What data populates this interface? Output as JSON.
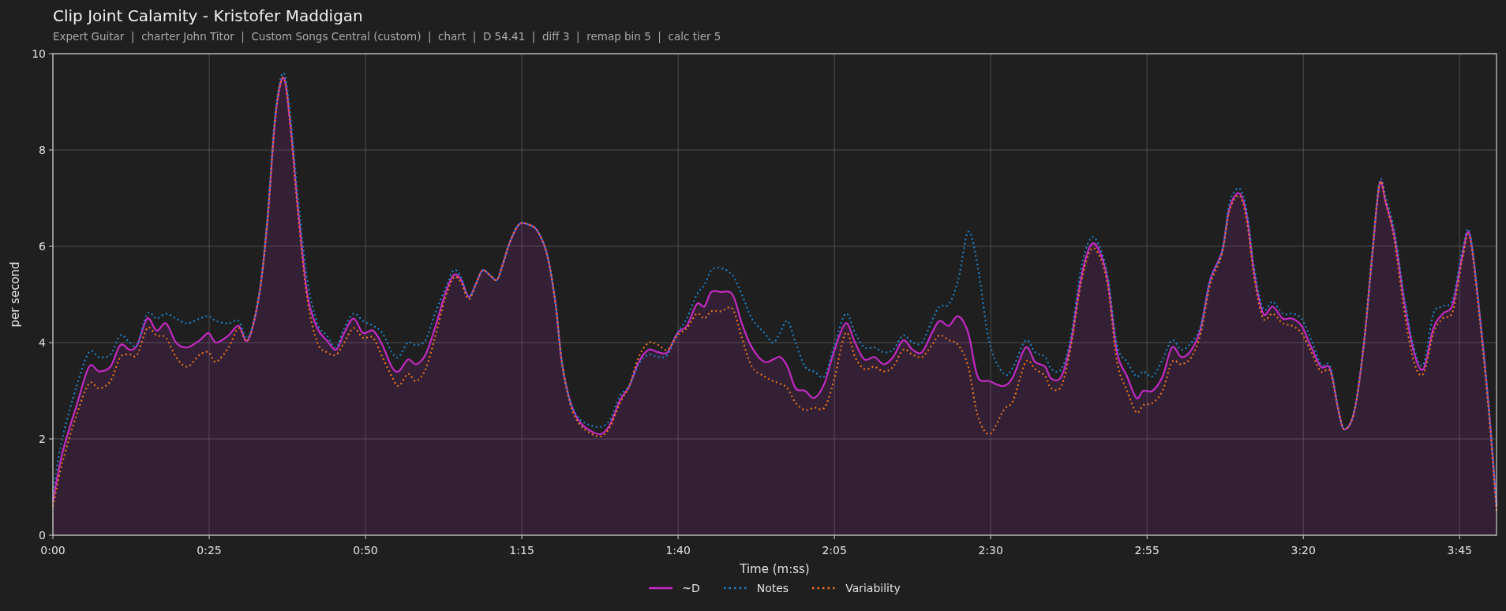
{
  "chart": {
    "subtitle": "Expert Guitar  |  charter John Titor  |  Custom Songs Central (custom)  |  chart  |  D 54.41  |  diff 3  |  remap bin 5  |  calc tier 5",
    "chart_data": {
      "type": "line",
      "title": "Clip Joint Calamity - Kristofer Maddigan",
      "xlabel": "Time (m:ss)",
      "ylabel": "per second",
      "xlim": [
        0,
        230.9
      ],
      "ylim": [
        0,
        10
      ],
      "grid": true,
      "xticks": [
        {
          "value": 0,
          "label": "0:00"
        },
        {
          "value": 25,
          "label": "0:25"
        },
        {
          "value": 50,
          "label": "0:50"
        },
        {
          "value": 75,
          "label": "1:15"
        },
        {
          "value": 100,
          "label": "1:40"
        },
        {
          "value": 125,
          "label": "2:05"
        },
        {
          "value": 150,
          "label": "2:30"
        },
        {
          "value": 175,
          "label": "2:55"
        },
        {
          "value": 200,
          "label": "3:20"
        },
        {
          "value": 225,
          "label": "3:45"
        }
      ],
      "yticks": [
        0,
        2,
        4,
        6,
        8,
        10
      ],
      "x": [
        0,
        1.5,
        3.8,
        5.8,
        7.4,
        9.2,
        10.8,
        12.3,
        13.5,
        15.1,
        16.6,
        18.1,
        19.7,
        21.5,
        23.5,
        24.9,
        26.1,
        28.1,
        29.7,
        31.2,
        33,
        34.3,
        35.6,
        36.9,
        38,
        39.2,
        40.7,
        42.3,
        43.8,
        45.3,
        46.6,
        48.1,
        49.6,
        51.2,
        52.7,
        54.2,
        55.3,
        56.8,
        58.1,
        59.6,
        61.1,
        62.7,
        64.1,
        65.3,
        66.5,
        67.6,
        68.7,
        69.9,
        71,
        71.9,
        73,
        74.5,
        76.1,
        77.6,
        79.1,
        80.4,
        81.4,
        82.7,
        84,
        85.6,
        87.6,
        89.1,
        90.7,
        92.2,
        93.7,
        95.3,
        96.8,
        98.3,
        99.9,
        101.4,
        103,
        104.2,
        105.3,
        106.8,
        108.7,
        110.2,
        111.8,
        113.8,
        115.2,
        116.3,
        117.5,
        118.8,
        120.3,
        121.8,
        123.4,
        124.9,
        126.8,
        128.3,
        129.8,
        131.4,
        132.9,
        134.4,
        136,
        137.5,
        139,
        140.6,
        141.8,
        143.3,
        144.8,
        146.4,
        147.9,
        149.8,
        152.1,
        153.6,
        155.6,
        157.1,
        158.7,
        159.7,
        161.3,
        162.8,
        164.4,
        165.9,
        167.2,
        168.7,
        170.2,
        171.8,
        173.3,
        174.4,
        175.9,
        177.5,
        179,
        180.5,
        182.1,
        183.6,
        185.1,
        187,
        188.2,
        189.8,
        191,
        192.2,
        193.6,
        195.1,
        196.7,
        198.2,
        199.7,
        201.3,
        202.8,
        204.3,
        205.6,
        206.6,
        208.2,
        209.7,
        211,
        212.2,
        213.2,
        214.6,
        216.2,
        217.7,
        219.2,
        220.8,
        222.3,
        223.9,
        225.4,
        226.6,
        228.2,
        229.7,
        230.9
      ],
      "series": [
        {
          "name": "~D",
          "color": "#c22ac2",
          "type": "area",
          "line_style": "solid",
          "values": [
            0.7,
            1.7,
            2.7,
            3.5,
            3.4,
            3.5,
            3.95,
            3.85,
            3.95,
            4.5,
            4.25,
            4.4,
            4.0,
            3.9,
            4.05,
            4.2,
            4.0,
            4.15,
            4.35,
            4.05,
            5.0,
            6.5,
            8.7,
            9.5,
            8.5,
            6.8,
            5.0,
            4.3,
            4.05,
            3.85,
            4.2,
            4.5,
            4.2,
            4.25,
            3.95,
            3.5,
            3.4,
            3.65,
            3.55,
            3.75,
            4.3,
            5.0,
            5.4,
            5.3,
            4.95,
            5.2,
            5.5,
            5.4,
            5.3,
            5.6,
            6.05,
            6.45,
            6.45,
            6.3,
            5.8,
            4.8,
            3.6,
            2.8,
            2.4,
            2.2,
            2.1,
            2.3,
            2.8,
            3.1,
            3.6,
            3.85,
            3.8,
            3.8,
            4.2,
            4.35,
            4.8,
            4.75,
            5.05,
            5.05,
            5.0,
            4.4,
            3.9,
            3.6,
            3.65,
            3.7,
            3.5,
            3.05,
            3.0,
            2.85,
            3.15,
            3.8,
            4.4,
            4.0,
            3.65,
            3.7,
            3.55,
            3.7,
            4.05,
            3.85,
            3.8,
            4.2,
            4.45,
            4.35,
            4.55,
            4.2,
            3.3,
            3.2,
            3.1,
            3.3,
            3.9,
            3.6,
            3.5,
            3.25,
            3.3,
            4.0,
            5.3,
            6.0,
            5.95,
            5.3,
            3.8,
            3.3,
            2.85,
            3.0,
            3.0,
            3.3,
            3.9,
            3.7,
            3.85,
            4.3,
            5.3,
            5.9,
            6.8,
            7.1,
            6.6,
            5.4,
            4.6,
            4.75,
            4.5,
            4.5,
            4.35,
            3.9,
            3.5,
            3.45,
            2.6,
            2.2,
            2.6,
            4.0,
            5.8,
            7.3,
            6.9,
            6.2,
            4.8,
            3.8,
            3.45,
            4.3,
            4.6,
            4.8,
            5.8,
            6.25,
            4.6,
            2.6,
            0.6
          ]
        },
        {
          "name": "Notes",
          "color": "#1f7fc4",
          "type": "line",
          "line_style": "dotted",
          "values": [
            0.9,
            2.0,
            3.1,
            3.8,
            3.7,
            3.75,
            4.15,
            4.0,
            3.95,
            4.6,
            4.5,
            4.6,
            4.5,
            4.4,
            4.5,
            4.55,
            4.45,
            4.4,
            4.45,
            4.1,
            5.0,
            6.6,
            8.8,
            9.6,
            8.7,
            7.0,
            5.3,
            4.4,
            4.15,
            3.9,
            4.3,
            4.6,
            4.45,
            4.35,
            4.2,
            3.8,
            3.7,
            4.0,
            3.95,
            4.05,
            4.6,
            5.1,
            5.5,
            5.35,
            4.95,
            5.2,
            5.5,
            5.4,
            5.3,
            5.6,
            6.05,
            6.45,
            6.45,
            6.3,
            5.8,
            4.8,
            3.6,
            2.8,
            2.45,
            2.3,
            2.25,
            2.4,
            2.9,
            3.1,
            3.55,
            3.75,
            3.7,
            3.75,
            4.2,
            4.5,
            5.0,
            5.2,
            5.5,
            5.55,
            5.4,
            5.0,
            4.5,
            4.2,
            4.0,
            4.2,
            4.45,
            4.0,
            3.5,
            3.4,
            3.3,
            3.9,
            4.6,
            4.2,
            3.9,
            3.9,
            3.8,
            3.85,
            4.15,
            4.0,
            4.0,
            4.45,
            4.75,
            4.8,
            5.3,
            6.3,
            5.6,
            4.0,
            3.35,
            3.5,
            4.05,
            3.8,
            3.7,
            3.45,
            3.45,
            4.1,
            5.5,
            6.15,
            6.05,
            5.4,
            3.95,
            3.6,
            3.3,
            3.4,
            3.3,
            3.65,
            4.05,
            3.85,
            4.0,
            4.35,
            5.3,
            5.9,
            6.9,
            7.2,
            6.7,
            5.5,
            4.7,
            4.85,
            4.6,
            4.6,
            4.5,
            4.05,
            3.55,
            3.5,
            2.6,
            2.2,
            2.6,
            4.0,
            5.8,
            7.35,
            7.0,
            6.3,
            4.9,
            3.9,
            3.55,
            4.6,
            4.75,
            4.9,
            5.9,
            6.3,
            4.6,
            2.6,
            0.6
          ]
        },
        {
          "name": "Variability",
          "color": "#e8731c",
          "type": "line",
          "line_style": "dotted",
          "values": [
            0.6,
            1.5,
            2.5,
            3.15,
            3.05,
            3.2,
            3.7,
            3.75,
            3.75,
            4.3,
            4.15,
            4.1,
            3.7,
            3.5,
            3.75,
            3.8,
            3.6,
            3.9,
            4.3,
            4.05,
            5.0,
            6.5,
            8.7,
            9.5,
            8.5,
            6.7,
            4.9,
            4.0,
            3.8,
            3.75,
            4.0,
            4.3,
            4.1,
            4.1,
            3.7,
            3.3,
            3.1,
            3.35,
            3.2,
            3.45,
            4.1,
            4.9,
            5.35,
            5.25,
            4.9,
            5.2,
            5.5,
            5.4,
            5.3,
            5.6,
            6.05,
            6.45,
            6.45,
            6.3,
            5.8,
            4.8,
            3.6,
            2.75,
            2.35,
            2.15,
            2.05,
            2.25,
            2.75,
            3.1,
            3.7,
            4.0,
            3.95,
            3.85,
            4.15,
            4.3,
            4.6,
            4.5,
            4.65,
            4.65,
            4.7,
            4.1,
            3.5,
            3.3,
            3.2,
            3.15,
            3.05,
            2.75,
            2.6,
            2.65,
            2.65,
            3.2,
            4.2,
            3.7,
            3.45,
            3.5,
            3.4,
            3.5,
            3.85,
            3.75,
            3.7,
            3.95,
            4.15,
            4.05,
            3.95,
            3.5,
            2.5,
            2.1,
            2.6,
            2.8,
            3.6,
            3.45,
            3.3,
            3.05,
            3.1,
            3.9,
            5.2,
            5.9,
            5.85,
            5.2,
            3.6,
            3.0,
            2.55,
            2.7,
            2.75,
            3.0,
            3.6,
            3.55,
            3.7,
            4.2,
            5.2,
            5.85,
            6.75,
            7.05,
            6.5,
            5.3,
            4.5,
            4.6,
            4.4,
            4.35,
            4.2,
            3.8,
            3.4,
            3.4,
            2.6,
            2.2,
            2.6,
            4.0,
            5.8,
            7.3,
            6.9,
            6.1,
            4.6,
            3.6,
            3.35,
            4.2,
            4.5,
            4.65,
            5.7,
            6.2,
            4.5,
            2.5,
            0.5
          ]
        }
      ]
    }
  }
}
